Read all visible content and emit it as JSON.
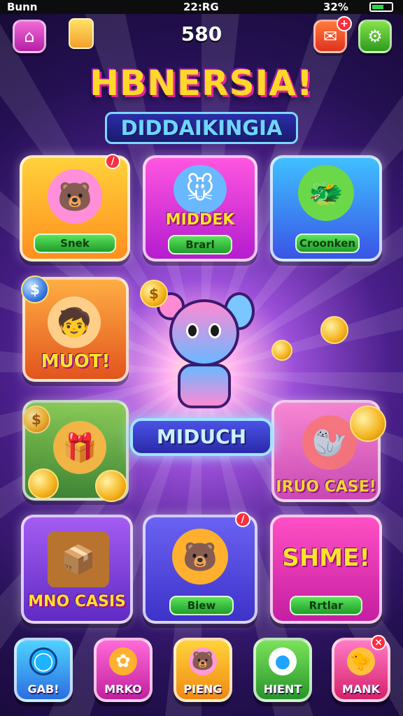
{
  "status_bar": {
    "carrier": "Bunn",
    "time": "22:RG",
    "battery": "32%"
  },
  "header": {
    "score": "580",
    "home_icon": "home-icon",
    "chat_icon": "chat-icon",
    "settings_icon": "gear-icon"
  },
  "title": {
    "main": "HBNERSIA!",
    "sub": "DIDDAIKINGIA"
  },
  "cards": {
    "c1": {
      "label": "Snek",
      "badge": "/"
    },
    "c2": {
      "label": "Brarl",
      "title": "MIDDEK"
    },
    "c3": {
      "label": "Croonken"
    },
    "c4": {
      "title": "MUOT!",
      "coin": "$"
    },
    "c5": {
      "coin": "$"
    },
    "c6": {
      "title": "IRUO CASE!"
    },
    "c7": {
      "title": "MNO CASIS"
    },
    "c8": {
      "label": "Biew",
      "badge": "/"
    },
    "c9": {
      "label": "Rrtlar",
      "title": "SHME!"
    }
  },
  "center": {
    "banner": "MIDUCH",
    "coin": "$"
  },
  "bottom_nav": [
    {
      "label": "GAB!",
      "icon": "bubble-icon"
    },
    {
      "label": "MRKO",
      "icon": "paw-icon"
    },
    {
      "label": "PIENG",
      "icon": "bear-icon"
    },
    {
      "label": "HIENT",
      "icon": "chat-bubble-icon"
    },
    {
      "label": "MANK",
      "icon": "duck-icon",
      "badge": "×"
    }
  ],
  "colors": {
    "title_yellow": "#ffd82a",
    "pill_green": "#5be35b",
    "coin_gold": "#f4b21c"
  }
}
